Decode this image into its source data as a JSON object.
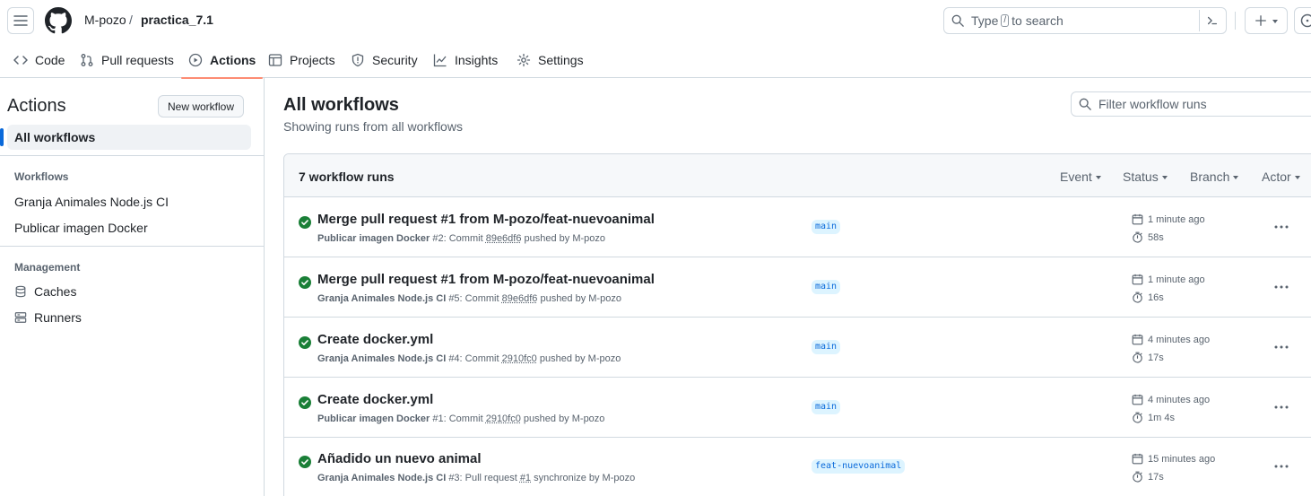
{
  "header": {
    "owner": "M-pozo",
    "separator": "/",
    "repo": "practica_7.1",
    "search_prefix": "Type",
    "search_key": "/",
    "search_suffix": "to search"
  },
  "nav": {
    "tabs": [
      {
        "label": "Code",
        "icon": "code-icon"
      },
      {
        "label": "Pull requests",
        "icon": "pull-request-icon"
      },
      {
        "label": "Actions",
        "icon": "play-icon",
        "active": true
      },
      {
        "label": "Projects",
        "icon": "table-icon"
      },
      {
        "label": "Security",
        "icon": "shield-icon"
      },
      {
        "label": "Insights",
        "icon": "graph-icon"
      },
      {
        "label": "Settings",
        "icon": "gear-icon"
      }
    ]
  },
  "sidebar": {
    "title": "Actions",
    "new_workflow_label": "New workflow",
    "active_item": "All workflows",
    "workflows_heading": "Workflows",
    "workflows": [
      "Granja Animales Node.js CI",
      "Publicar imagen Docker"
    ],
    "management_heading": "Management",
    "management": [
      {
        "label": "Caches",
        "icon": "database-icon"
      },
      {
        "label": "Runners",
        "icon": "server-icon"
      }
    ]
  },
  "main": {
    "title": "All workflows",
    "subtitle": "Showing runs from all workflows",
    "filter_placeholder": "Filter workflow runs",
    "runs_count": "7 workflow runs",
    "filters": [
      "Event",
      "Status",
      "Branch",
      "Actor"
    ],
    "runs": [
      {
        "title": "Merge pull request #1 from M-pozo/feat-nuevoanimal",
        "workflow": "Publicar imagen Docker",
        "num": "#2: Commit",
        "ref": "89e6df6",
        "action": "pushed by M-pozo",
        "branch": "main",
        "when": "1 minute ago",
        "duration": "58s",
        "status": "success"
      },
      {
        "title": "Merge pull request #1 from M-pozo/feat-nuevoanimal",
        "workflow": "Granja Animales Node.js CI",
        "num": "#5: Commit",
        "ref": "89e6df6",
        "action": "pushed by M-pozo",
        "branch": "main",
        "when": "1 minute ago",
        "duration": "16s",
        "status": "success"
      },
      {
        "title": "Create docker.yml",
        "workflow": "Granja Animales Node.js CI",
        "num": "#4: Commit",
        "ref": "2910fc0",
        "action": "pushed by M-pozo",
        "branch": "main",
        "when": "4 minutes ago",
        "duration": "17s",
        "status": "success"
      },
      {
        "title": "Create docker.yml",
        "workflow": "Publicar imagen Docker",
        "num": "#1: Commit",
        "ref": "2910fc0",
        "action": "pushed by M-pozo",
        "branch": "main",
        "when": "4 minutes ago",
        "duration": "1m 4s",
        "status": "success"
      },
      {
        "title": "Añadido un nuevo animal",
        "workflow": "Granja Animales Node.js CI",
        "num": "#3: Pull request",
        "ref": "#1",
        "action": "synchronize by M-pozo",
        "branch": "feat-nuevoanimal",
        "when": "15 minutes ago",
        "duration": "17s",
        "status": "success"
      }
    ]
  },
  "colors": {
    "accent": "#0969da",
    "success": "#1a7f37",
    "active_tab_underline": "#fd8c73",
    "branch_bg": "#ddf4ff"
  }
}
